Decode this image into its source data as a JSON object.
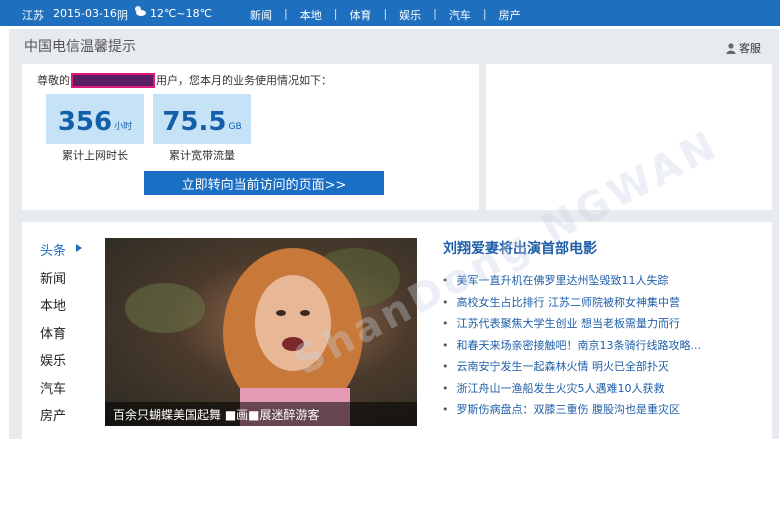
{
  "topbar": {
    "location": "江苏",
    "date": "2015-03-16",
    "weather": "阴",
    "weather_icon": "cloud-sun-icon",
    "temperature": "12℃~18℃",
    "nav": [
      "新闻",
      "本地",
      "体育",
      "娱乐",
      "汽车",
      "房产"
    ],
    "separator": "|"
  },
  "panel": {
    "title": "中国电信温馨提示",
    "service_label": "客服",
    "greeting_prefix": "尊敬的",
    "greeting_suffix": "用户，您本月的业务使用情况如下：",
    "stats": [
      {
        "value": "356",
        "unit": "小时",
        "label": "累计上网时长"
      },
      {
        "value": "75.5",
        "unit": "GB",
        "label": "累计宽带流量"
      }
    ],
    "button_label": "立即转向当前访问的页面>>"
  },
  "news": {
    "categories": [
      "头条",
      "新闻",
      "本地",
      "体育",
      "娱乐",
      "汽车",
      "房产"
    ],
    "active_category": "头条",
    "photo_caption": "百余只蝴蝶美国起舞 ■画■展迷醉游客",
    "headline": "刘翔爱妻将出演首部电影",
    "items": [
      "美军一直升机在佛罗里达州坠毁致11人失踪",
      "高校女生占比排行 江苏二师院被称女神集中营",
      "江苏代表聚焦大学生创业 想当老板需量力而行",
      "和春天来场亲密接触吧！南京13条骑行线路攻略...",
      "云南安宁发生一起森林火情 明火已全部扑灭",
      "浙江舟山一渔船发生火灾5人遇难10人获救",
      "罗斯伤病盘点：双膝三重伤 腹股沟也是重灾区"
    ]
  },
  "watermark": "ShanDong NGWAN"
}
